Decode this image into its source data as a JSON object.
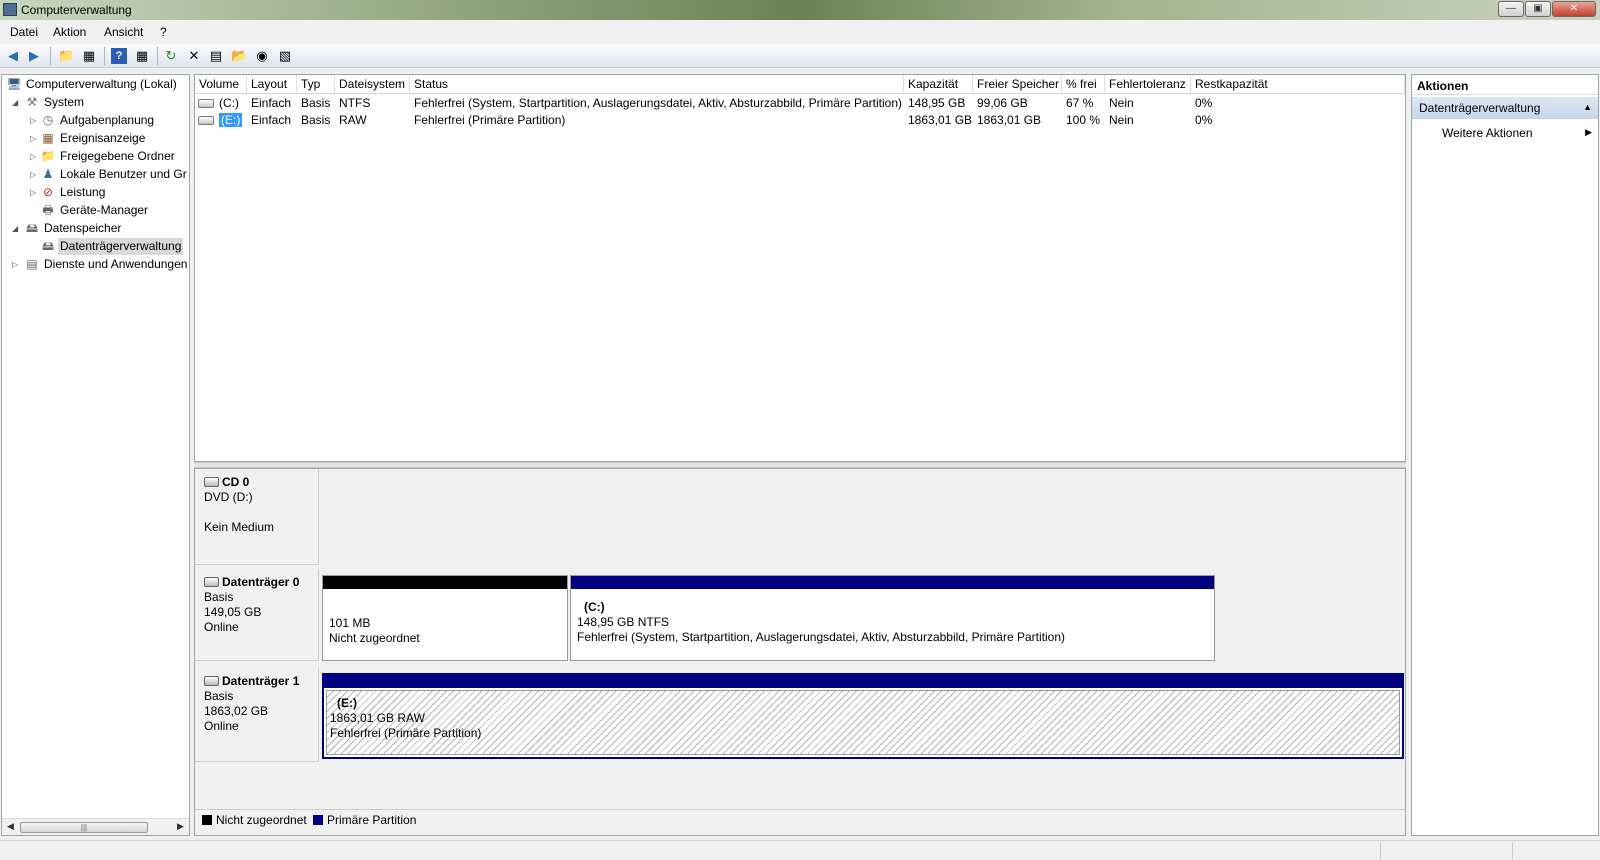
{
  "window": {
    "title": "Computerverwaltung"
  },
  "menu": [
    "Datei",
    "Aktion",
    "Ansicht",
    "?"
  ],
  "tree": {
    "items": [
      {
        "label": "Computerverwaltung (Lokal)",
        "icon": "computer-icon",
        "level": 0,
        "expander": ""
      },
      {
        "label": "System",
        "icon": "tools-icon",
        "level": 1,
        "expander": "expanded"
      },
      {
        "label": "Aufgabenplanung",
        "icon": "clock-icon",
        "level": 2,
        "expander": "collapsed"
      },
      {
        "label": "Ereignisanzeige",
        "icon": "event-viewer-icon",
        "level": 2,
        "expander": "collapsed"
      },
      {
        "label": "Freigegebene Ordner",
        "icon": "shared-folder-icon",
        "level": 2,
        "expander": "collapsed"
      },
      {
        "label": "Lokale Benutzer und Gr",
        "icon": "users-icon",
        "level": 2,
        "expander": "collapsed"
      },
      {
        "label": "Leistung",
        "icon": "performance-icon",
        "level": 2,
        "expander": "collapsed"
      },
      {
        "label": "Geräte-Manager",
        "icon": "device-manager-icon",
        "level": 2,
        "expander": ""
      },
      {
        "label": "Datenspeicher",
        "icon": "storage-icon",
        "level": 1,
        "expander": "expanded"
      },
      {
        "label": "Datenträgerverwaltung",
        "icon": "disk-management-icon",
        "level": 2,
        "expander": "",
        "selected": true
      },
      {
        "label": "Dienste und Anwendungen",
        "icon": "services-icon",
        "level": 1,
        "expander": "collapsed"
      }
    ]
  },
  "volumes": {
    "columns": [
      "Volume",
      "Layout",
      "Typ",
      "Dateisystem",
      "Status",
      "Kapazität",
      "Freier Speicher",
      "% frei",
      "Fehlertoleranz",
      "Restkapazität"
    ],
    "rows": [
      [
        "(C:)",
        "Einfach",
        "Basis",
        "NTFS",
        "Fehlerfrei (System, Startpartition, Auslagerungsdatei, Aktiv, Absturzabbild, Primäre Partition)",
        "148,95 GB",
        "99,06 GB",
        "67 %",
        "Nein",
        "0%"
      ],
      [
        "(E:)",
        "Einfach",
        "Basis",
        "RAW",
        "Fehlerfrei (Primäre Partition)",
        "1863,01 GB",
        "1863,01 GB",
        "100 %",
        "Nein",
        "0%"
      ]
    ]
  },
  "disks": {
    "cd0": {
      "name": "CD 0",
      "line1": "DVD (D:)",
      "line2": "Kein Medium"
    },
    "disk0": {
      "name": "Datenträger 0",
      "type": "Basis",
      "size": "149,05 GB",
      "state": "Online",
      "part1": {
        "size": "101 MB",
        "desc": "Nicht zugeordnet"
      },
      "part2": {
        "letter": "(C:)",
        "size": "148,95 GB NTFS",
        "desc": "Fehlerfrei (System, Startpartition, Auslagerungsdatei, Aktiv, Absturzabbild, Primäre Partition)"
      }
    },
    "disk1": {
      "name": "Datenträger 1",
      "type": "Basis",
      "size": "1863,02 GB",
      "state": "Online",
      "part1": {
        "letter": "(E:)",
        "size": "1863,01 GB RAW",
        "desc": "Fehlerfrei (Primäre Partition)"
      }
    }
  },
  "legend": [
    {
      "label": "Nicht zugeordnet",
      "color": "#000000"
    },
    {
      "label": "Primäre Partition",
      "color": "#000080"
    }
  ],
  "actions": {
    "header": "Aktionen",
    "section": "Datenträgerverwaltung",
    "more": "Weitere Aktionen"
  },
  "colors": {
    "primary_partition": "#000080",
    "unallocated": "#000000",
    "selection": "#3399ff"
  }
}
